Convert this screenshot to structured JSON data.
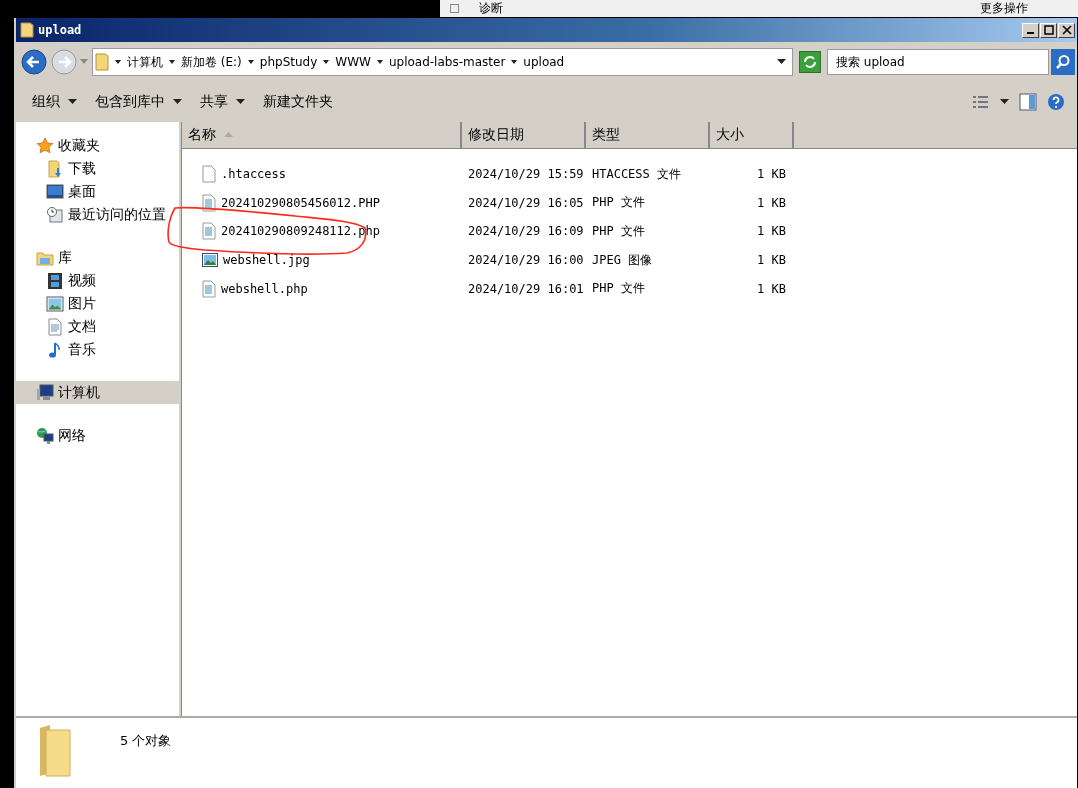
{
  "background": {
    "texts": [
      "诊断",
      "更多操作"
    ]
  },
  "window": {
    "title": "upload"
  },
  "address": {
    "path": [
      "计算机",
      "新加卷 (E:)",
      "phpStudy",
      "WWW",
      "upload-labs-master",
      "upload"
    ]
  },
  "search": {
    "placeholder": "搜索 upload"
  },
  "toolbar": [
    {
      "label": "组织",
      "dropdown": true
    },
    {
      "label": "包含到库中",
      "dropdown": true
    },
    {
      "label": "共享",
      "dropdown": true
    },
    {
      "label": "新建文件夹",
      "dropdown": false
    }
  ],
  "sidebar": {
    "sections": [
      {
        "label": "收藏夹",
        "kind": "star",
        "selected": false,
        "children": [
          {
            "label": "下载",
            "kind": "download",
            "selected": false
          },
          {
            "label": "桌面",
            "kind": "desktop",
            "selected": false
          },
          {
            "label": "最近访问的位置",
            "kind": "recent",
            "selected": false
          }
        ]
      },
      {
        "label": "库",
        "kind": "library",
        "selected": false,
        "children": [
          {
            "label": "视频",
            "kind": "video",
            "selected": false
          },
          {
            "label": "图片",
            "kind": "image",
            "selected": false
          },
          {
            "label": "文档",
            "kind": "document",
            "selected": false
          },
          {
            "label": "音乐",
            "kind": "music",
            "selected": false
          }
        ]
      },
      {
        "label": "计算机",
        "kind": "computer",
        "selected": true
      },
      {
        "label": "网络",
        "kind": "network",
        "selected": false
      }
    ]
  },
  "table": {
    "columns": [
      {
        "label": "名称",
        "sorted": true
      },
      {
        "label": "修改日期",
        "sorted": false
      },
      {
        "label": "类型",
        "sorted": false
      },
      {
        "label": "大小",
        "sorted": false
      }
    ],
    "rows": [
      {
        "name": ".htaccess",
        "kind": "blank",
        "modified": "2024/10/29 15:59",
        "type": "HTACCESS 文件",
        "size": "1 KB",
        "circled": false
      },
      {
        "name": "202410290805456012.PHP",
        "kind": "script",
        "modified": "2024/10/29 16:05",
        "type": "PHP 文件",
        "size": "1 KB",
        "circled": false
      },
      {
        "name": "202410290809248112.php",
        "kind": "script",
        "modified": "2024/10/29 16:09",
        "type": "PHP 文件",
        "size": "1 KB",
        "circled": true
      },
      {
        "name": "webshell.jpg",
        "kind": "image",
        "modified": "2024/10/29 16:00",
        "type": "JPEG 图像",
        "size": "1 KB",
        "circled": false
      },
      {
        "name": "webshell.php",
        "kind": "script",
        "modified": "2024/10/29 16:01",
        "type": "PHP 文件",
        "size": "1 KB",
        "circled": false
      }
    ]
  },
  "status_bar": {
    "text": "5 个对象"
  }
}
